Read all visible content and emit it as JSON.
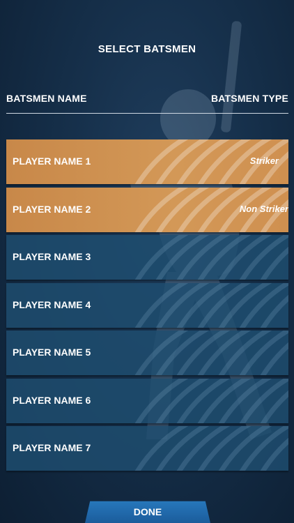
{
  "header": {
    "title": "SELECT BATSMEN"
  },
  "columns": {
    "name": "BATSMEN NAME",
    "type": "BATSMEN TYPE"
  },
  "players": [
    {
      "name": "PLAYER NAME 1",
      "type": "Striker",
      "selected": true
    },
    {
      "name": "PLAYER NAME 2",
      "type": "Non Striker",
      "selected": true
    },
    {
      "name": "PLAYER NAME 3",
      "type": "",
      "selected": false
    },
    {
      "name": "PLAYER NAME 4",
      "type": "",
      "selected": false
    },
    {
      "name": "PLAYER NAME 5",
      "type": "",
      "selected": false
    },
    {
      "name": "PLAYER NAME 6",
      "type": "",
      "selected": false
    },
    {
      "name": "PLAYER NAME 7",
      "type": "",
      "selected": false
    }
  ],
  "footer": {
    "done_label": "DONE"
  },
  "colors": {
    "selected_row": "#d39857",
    "row": "#1e4e70",
    "done_button": "#2a7fc4",
    "background": "#16304b"
  }
}
